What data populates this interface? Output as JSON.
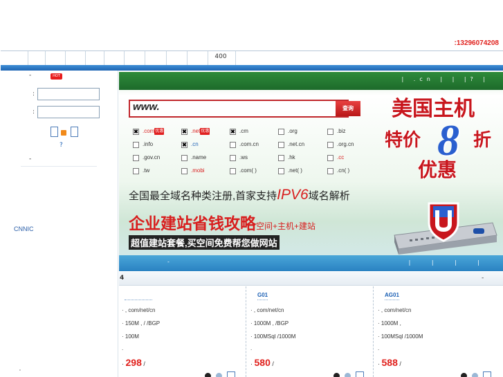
{
  "header": {
    "phone": ":13296074208"
  },
  "nav": {
    "item_400": "400"
  },
  "left": {
    "dash_top": "-",
    "hot_badge": "HOT",
    "colon1": ":",
    "colon2": ":",
    "help_q": "?",
    "dash_mid": "-",
    "cnnic": "CNNIC",
    "tiny": "'"
  },
  "banner": {
    "top_links": "| .cn |  |  |? |",
    "www": "www.",
    "search_btn": "查询",
    "domains": [
      {
        "label": ".com",
        "checked": true,
        "style": "red",
        "badge": "优惠"
      },
      {
        "label": ".net",
        "checked": true,
        "style": "red",
        "badge": "优惠"
      },
      {
        "label": ".cm",
        "checked": true,
        "style": "",
        "badge": ""
      },
      {
        "label": ".org",
        "checked": false,
        "style": "",
        "badge": ""
      },
      {
        "label": ".biz",
        "checked": false,
        "style": "",
        "badge": ""
      },
      {
        "label": ".info",
        "checked": false,
        "style": "",
        "badge": ""
      },
      {
        "label": ".cn",
        "checked": true,
        "style": "blue",
        "badge": ""
      },
      {
        "label": ".com.cn",
        "checked": false,
        "style": "",
        "badge": ""
      },
      {
        "label": ".net.cn",
        "checked": false,
        "style": "",
        "badge": ""
      },
      {
        "label": ".org.cn",
        "checked": false,
        "style": "",
        "badge": ""
      },
      {
        "label": ".gov.cn",
        "checked": false,
        "style": "",
        "badge": ""
      },
      {
        "label": ".name",
        "checked": false,
        "style": "",
        "badge": ""
      },
      {
        "label": ".ws",
        "checked": false,
        "style": "",
        "badge": ""
      },
      {
        "label": ".hk",
        "checked": false,
        "style": "",
        "badge": ""
      },
      {
        "label": ".cc",
        "checked": false,
        "style": "red",
        "badge": ""
      },
      {
        "label": ".tw",
        "checked": false,
        "style": "",
        "badge": ""
      },
      {
        "label": ".mobi",
        "checked": false,
        "style": "red",
        "badge": ""
      },
      {
        "label": ".com( )",
        "checked": false,
        "style": "",
        "badge": ""
      },
      {
        "label": ".net( )",
        "checked": false,
        "style": "",
        "badge": ""
      },
      {
        "label": ".cn( )",
        "checked": false,
        "style": "",
        "badge": ""
      }
    ],
    "slogan1_pre": "全国最全域名种类注册,首家支持",
    "slogan1_big": "IPV6",
    "slogan1_post": "域名解析",
    "slogan2_main": "企业建站省钱攻略",
    "slogan2_small": "空间+主机+建站",
    "slogan3": "超值建站套餐,买空间免费帮您做网站",
    "promo_line1": "美国主机",
    "promo_line2_a": "特价",
    "promo_8": "8",
    "promo_line2_b": "折",
    "promo_line3": "优惠",
    "bottom_links": "| | | |",
    "bottom_dash": "-"
  },
  "products": {
    "section_num": "4",
    "section_dash": "-",
    "items": [
      {
        "title": "",
        "line1": ", com/net/cn",
        "line2": "150M ,  / /BGP",
        "line3": "100M",
        "line4": ".",
        "price": "298",
        "price_suffix": "/"
      },
      {
        "title": "G01",
        "line1": ", com/net/cn",
        "line2": "1000M ,  /BGP",
        "line3": "100MSql  /1000M",
        "line4": ".",
        "price": "580",
        "price_suffix": "/"
      },
      {
        "title": "AG01",
        "line1": ", com/net/cn",
        "line2": "1000M ,",
        "line3": "100MSql  /1000M",
        "line4": ".",
        "price": "588",
        "price_suffix": "/"
      }
    ]
  }
}
